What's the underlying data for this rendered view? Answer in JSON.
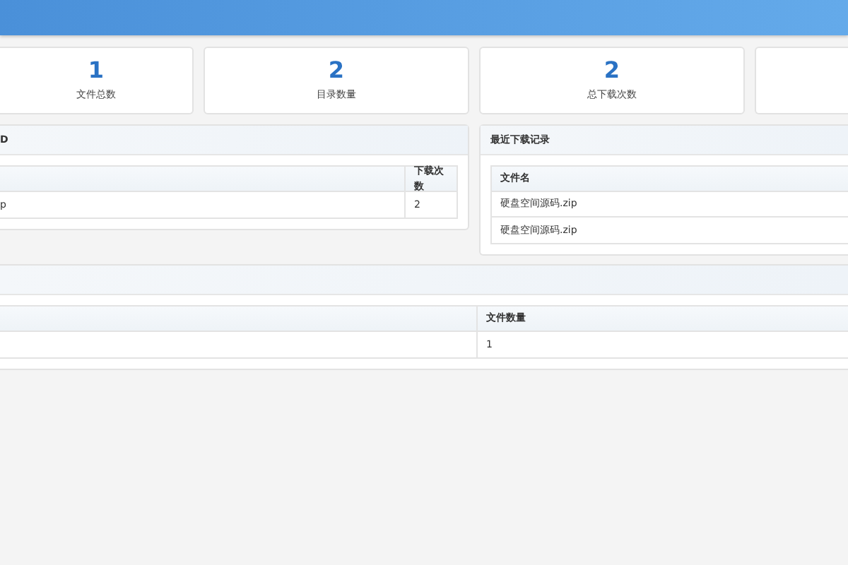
{
  "stats": [
    {
      "value": "1",
      "label": "文件总数"
    },
    {
      "value": "2",
      "label": "目录数量"
    },
    {
      "value": "2",
      "label": "总下载次数"
    }
  ],
  "top_panel": {
    "title": "D",
    "column_2": "下载次数",
    "rows": [
      {
        "column_1": "p",
        "column_2": "2"
      }
    ]
  },
  "recent_panel": {
    "title": "最近下载记录",
    "column_1": "文件名",
    "rows": [
      {
        "column_1": "硬盘空间源码.zip"
      },
      {
        "column_1": "硬盘空间源码.zip"
      }
    ]
  },
  "bottom_panel": {
    "column_2": "文件数量",
    "rows": [
      {
        "column_2": "1"
      }
    ]
  }
}
